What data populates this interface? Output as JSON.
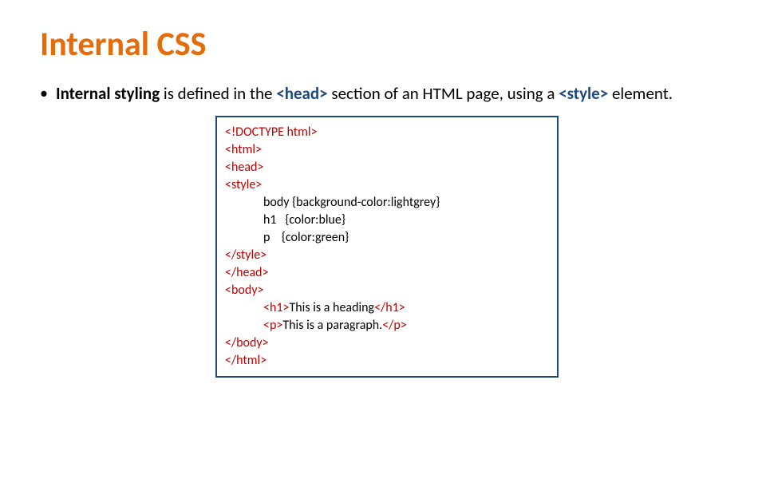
{
  "title": "Internal CSS",
  "bullet": {
    "part1": "Internal styling",
    "part2": " is defined in the ",
    "tag1": "<head>",
    "part3": " section of an HTML page, using a ",
    "tag2": "<style>",
    "part4": " element."
  },
  "code": {
    "l1": "<!DOCTYPE html>",
    "l2": "<html>",
    "l3": "<head>",
    "l4": "<style>",
    "l5": "body {background-color:lightgrey}",
    "l6": "h1   {color:blue}",
    "l7": "p    {color:green}",
    "l8": "</style>",
    "l9": "</head>",
    "l10": "<body>",
    "l11a": "<h1>",
    "l11b": "This is a heading",
    "l11c": "</h1>",
    "l12a": "<p>",
    "l12b": "This is a paragraph.",
    "l12c": "</p>",
    "l13": "</body>",
    "l14": "</html>"
  }
}
